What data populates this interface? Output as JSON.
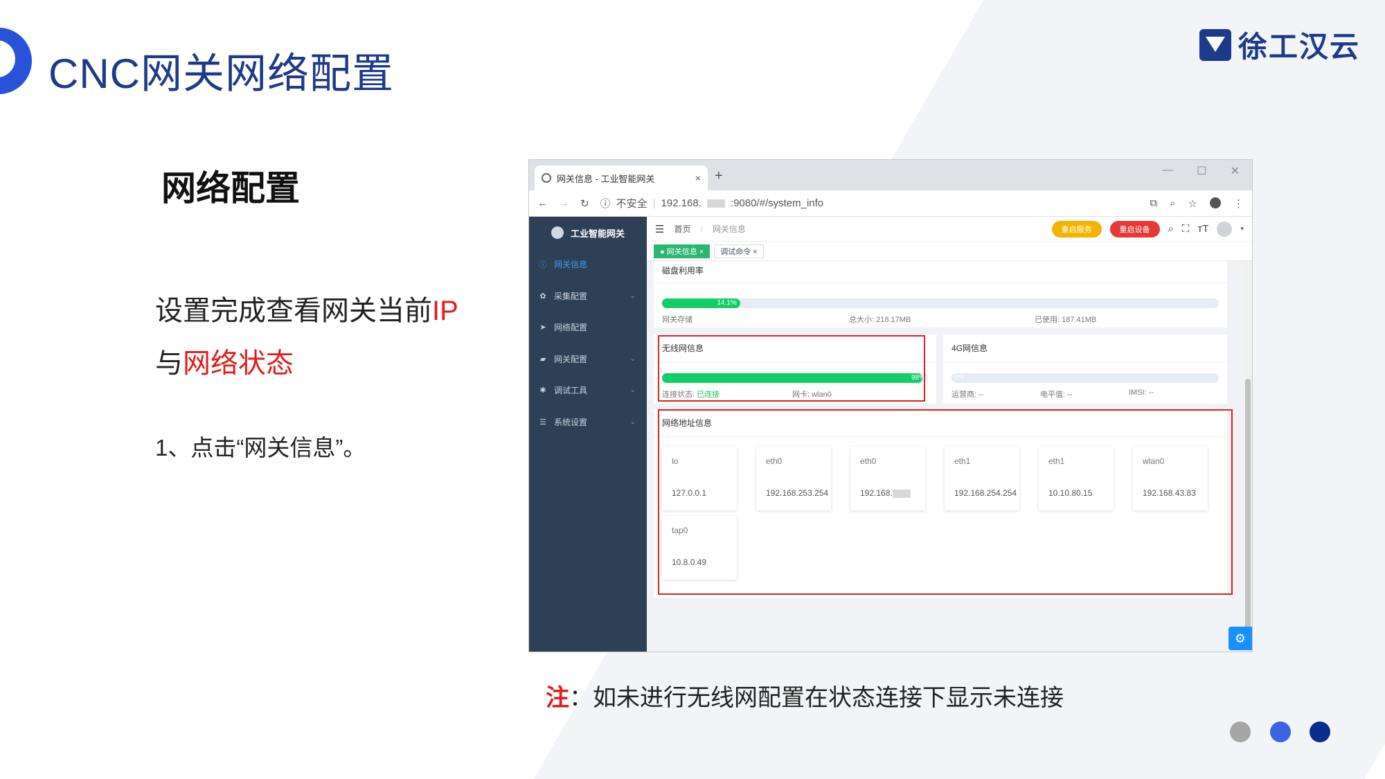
{
  "slide": {
    "title": "CNC网关网络配置",
    "logo_text": "徐工汉云",
    "section_title": "网络配置",
    "para1_a": "设置完成查看网关当前",
    "para1_b": "IP",
    "para2_a": "与",
    "para2_b": "网络状态",
    "step1": "1、点击“网关信息”。",
    "note_label": "注",
    "note_text": "：如未进行无线网配置在状态连接下显示未连接"
  },
  "browser": {
    "tab_title": "网关信息 - 工业智能网关",
    "tab_close": "×",
    "new_tab": "+",
    "win_min": "—",
    "win_max": "☐",
    "win_close": "✕",
    "insecure": "不安全",
    "url_a": "192.168.",
    "url_b": ":9080/#/system_info"
  },
  "app": {
    "brand": "工业智能网关",
    "menu": [
      {
        "label": "网关信息",
        "icon": "info-icon"
      },
      {
        "label": "采集配置",
        "icon": "collect-icon"
      },
      {
        "label": "网络配置",
        "icon": "send-icon"
      },
      {
        "label": "网关配置",
        "icon": "lock-icon"
      },
      {
        "label": "调试工具",
        "icon": "bug-icon"
      },
      {
        "label": "系统设置",
        "icon": "list-icon"
      }
    ],
    "breadcrumb_home": "首页",
    "breadcrumb_sep": "/",
    "breadcrumb_current": "网关信息",
    "restart_service": "重启服务",
    "restart_device": "重启设备",
    "tags": [
      {
        "label": "● 网关信息 ×"
      },
      {
        "label": "调试命令 ×"
      }
    ],
    "disk": {
      "title": "磁盘利用率",
      "percent": 14.1,
      "percent_label": "14.1%",
      "storage_label": "网关存储",
      "total_label": "总大小: 218.17MB",
      "used_label": "已使用: 187.41MB"
    },
    "wifi": {
      "title": "无线网信息",
      "percent": 98,
      "percent_label": "98%",
      "status_prefix": "连接状态: ",
      "status_value": "已连接",
      "nic_label": "网卡: wlan0"
    },
    "g4": {
      "title": "4G网信息",
      "percent": 0,
      "percent_label": "0%",
      "operator_label": "运营商: --",
      "level_label": "电平值: --",
      "imsi_label": "IMSI: --"
    },
    "net": {
      "title": "网络地址信息",
      "interfaces": [
        {
          "name": "lo",
          "ip": "127.0.0.1"
        },
        {
          "name": "eth0",
          "ip": "192.168.253.254"
        },
        {
          "name": "eth0",
          "ip": "192.168."
        },
        {
          "name": "eth1",
          "ip": "192.168.254.254"
        },
        {
          "name": "eth1",
          "ip": "10.10.80.15"
        },
        {
          "name": "wlan0",
          "ip": "192.168.43.83"
        },
        {
          "name": "tap0",
          "ip": "10.8.0.49"
        }
      ]
    }
  },
  "colors": {
    "title_blue": "#1e3a8a",
    "highlight_red": "#e31b1b",
    "sidebar": "#2d4055",
    "progress_green": "#13ce66"
  }
}
